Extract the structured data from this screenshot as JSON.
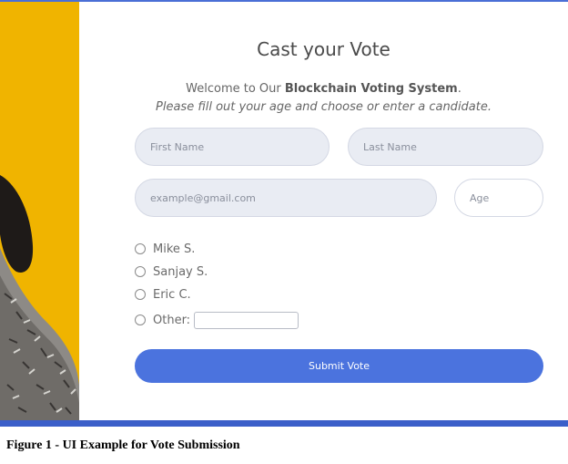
{
  "form": {
    "title": "Cast your Vote",
    "welcome_prefix": "Welcome to Our ",
    "welcome_bold": "Blockchain Voting System",
    "welcome_suffix": ".",
    "instructions": "Please fill out your age and choose or enter a candidate.",
    "first_name_placeholder": "First Name",
    "last_name_placeholder": "Last Name",
    "email_placeholder": "example@gmail.com",
    "age_placeholder": "Age",
    "candidates": [
      "Mike S.",
      "Sanjay S.",
      "Eric C."
    ],
    "other_label": "Other:",
    "submit_label": "Submit Vote"
  },
  "caption": "Figure 1 - UI Example for Vote Submission",
  "colors": {
    "accent": "#4b73de",
    "side_panel": "#f0b400",
    "input_bg": "#e9ecf3"
  }
}
